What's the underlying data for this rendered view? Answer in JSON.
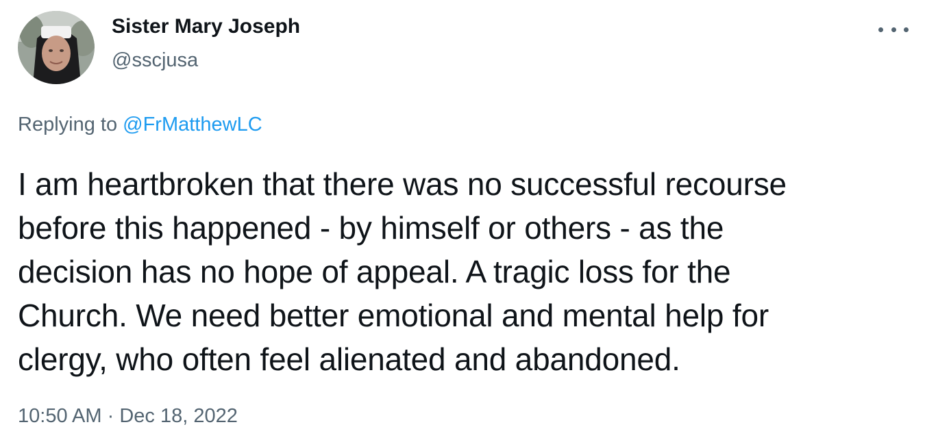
{
  "tweet": {
    "author": {
      "display_name": "Sister Mary Joseph",
      "handle": "@sscjusa",
      "avatar": "nun-portrait-avatar"
    },
    "more_icon": "ellipsis-icon",
    "reply": {
      "prefix": "Replying to",
      "mention": "@FrMatthewLC"
    },
    "text": "I am heartbroken that there was no successful recourse\nbefore this happened - by himself or others - as the\ndecision has no hope of appeal. A tragic loss for the\nChurch.  We need better emotional and mental help for\nclergy, who often feel alienated and abandoned.",
    "time": "10:50 AM",
    "separator": "·",
    "date": "Dec 18, 2022"
  },
  "colors": {
    "text_primary": "#0f1419",
    "text_secondary": "#536471",
    "link": "#1d9bf0",
    "background": "#ffffff"
  }
}
